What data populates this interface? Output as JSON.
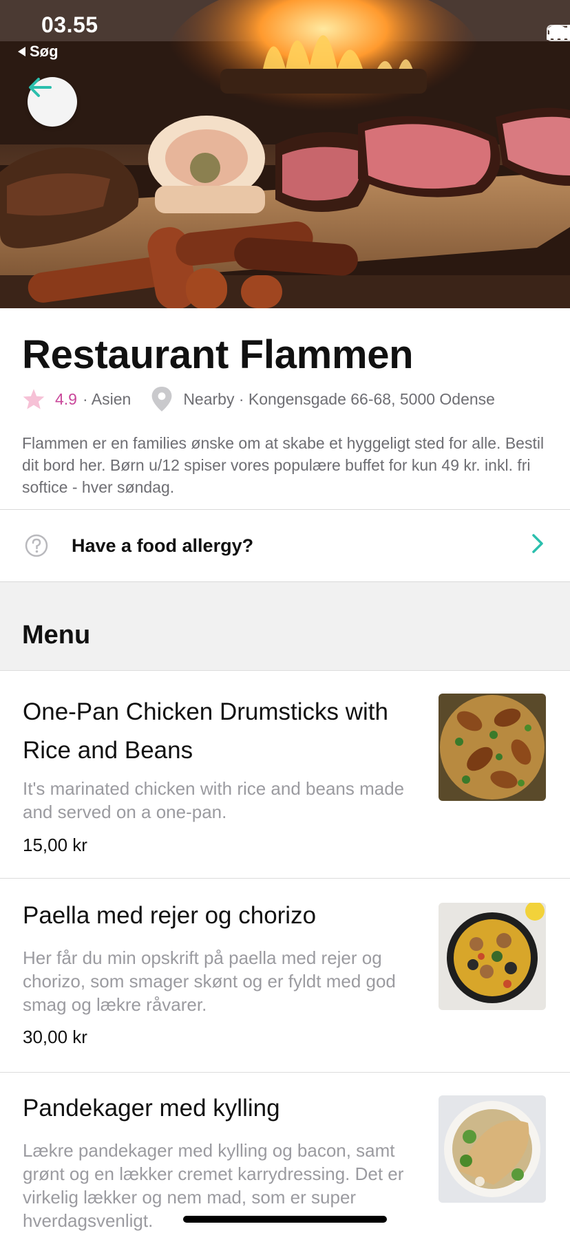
{
  "status_bar": {
    "time": "03.55",
    "back_label": "Søg"
  },
  "restaurant": {
    "name": "Restaurant Flammen",
    "rating": "4.9",
    "cuisine": "· Asien",
    "location": "Nearby · Kongensgade 66-68, 5000 Odense",
    "description": "Flammen er en families ønske om at skabe et hyggeligt sted for alle. Bestil dit bord her. Børn u/12 spiser vores populære buffet for kun 49 kr. inkl. fri softice - hver søndag."
  },
  "allergy": {
    "label": "Have a food allergy?"
  },
  "menu": {
    "title": "Menu",
    "items": [
      {
        "name": "One-Pan Chicken Drumsticks with Rice and Beans",
        "description": "It's marinated chicken with rice and beans made and served on a one-pan.",
        "price": "15,00 kr"
      },
      {
        "name": "Paella med rejer og chorizo",
        "description": "Her får du min opskrift på paella med rejer og chorizo, som smager skønt og er fyldt med god smag og lækre råvarer.",
        "price": "30,00 kr"
      },
      {
        "name": "Pandekager med kylling",
        "description": "Lækre pandekager med kylling og bacon, samt grønt og en lækker cremet karrydressing. Det er virkelig lækker og nem mad, som er super hverdagsvenligt.",
        "price": ""
      }
    ]
  },
  "colors": {
    "accent": "#2bbfad",
    "rating": "#c9479a",
    "star": "#f6c1d6",
    "muted": "#6e6e73"
  },
  "icons": [
    "back-arrow-icon",
    "star-icon",
    "location-pin-icon",
    "question-circle-icon",
    "chevron-right-icon",
    "signal-icon",
    "wifi-icon",
    "battery-icon"
  ]
}
